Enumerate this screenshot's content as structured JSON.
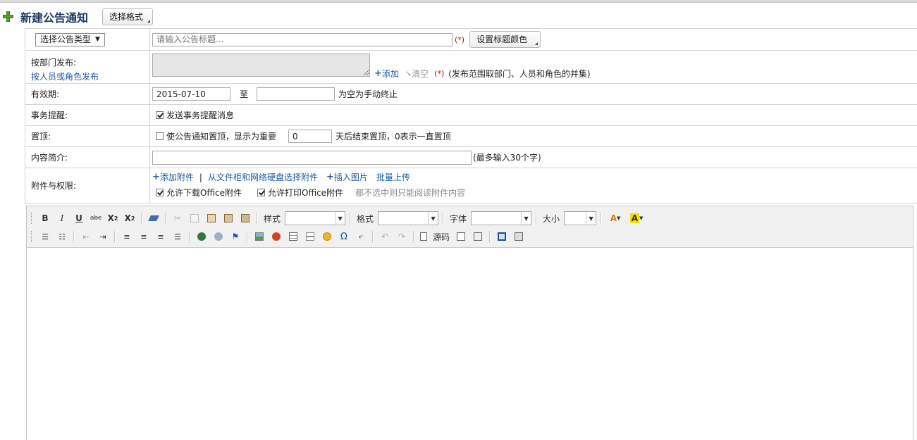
{
  "header": {
    "title": "新建公告通知",
    "format_button": "选择格式"
  },
  "rows": {
    "type_title": {
      "type_select": "选择公告类型",
      "title_placeholder": "请输入公告标题...",
      "required_mark": "(*)",
      "title_color_button": "设置标题颜色"
    },
    "publish": {
      "label_dept": "按部门发布:",
      "label_person": "按人员或角色发布",
      "add_link": "添加",
      "clear_link": "清空",
      "required_mark": "(*)",
      "note": "(发布范围取部门、人员和角色的并集)"
    },
    "validity": {
      "label": "有效期:",
      "start_value": "2015-07-10",
      "to": "至",
      "end_value": "",
      "note": "为空为手动终止"
    },
    "reminder": {
      "label": "事务提醒:",
      "checkbox_label": "发送事务提醒消息",
      "checked": true
    },
    "pin": {
      "label": "置顶:",
      "checkbox_label": "使公告通知置顶，显示为重要",
      "checked": false,
      "days_value": "0",
      "note": "天后结束置顶，0表示一直置顶"
    },
    "summary": {
      "label": "内容简介:",
      "value": "",
      "note": "(最多输入30个字)"
    },
    "attachments": {
      "label": "附件与权限:",
      "add_attachment": "添加附件",
      "divider": "|",
      "from_cabinet": "从文件柜和网络硬盘选择附件",
      "insert_image": "插入图片",
      "batch_upload": "批量上传",
      "allow_download": "允许下载Office附件",
      "allow_print": "允许打印Office附件",
      "hint": "都不选中则只能阅读附件内容"
    }
  },
  "editor": {
    "style_label": "样式",
    "format_label": "格式",
    "font_label": "字体",
    "size_label": "大小",
    "source_label": "源码"
  }
}
